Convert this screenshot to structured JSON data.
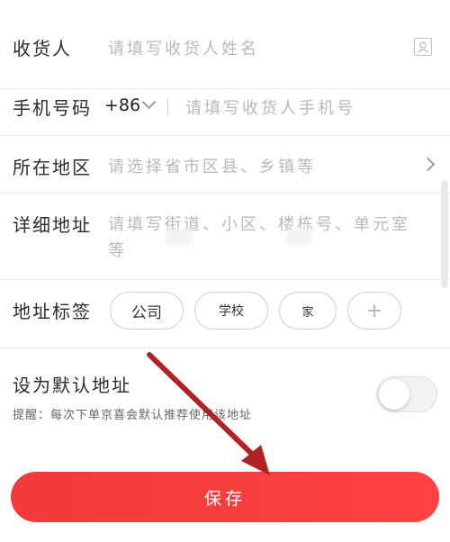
{
  "form": {
    "recipient": {
      "label": "收货人",
      "placeholder": "请填写收货人姓名"
    },
    "phone": {
      "label": "手机号码",
      "country_code": "+86",
      "placeholder": "请填写收货人手机号"
    },
    "region": {
      "label": "所在地区",
      "placeholder": "请选择省市区县、乡镇等"
    },
    "address": {
      "label": "详细地址",
      "placeholder_line1": "请填写街道、小区、楼栋号、单元室",
      "placeholder_line2": "等"
    },
    "tags": {
      "label": "地址标签",
      "items": [
        "公司",
        "学校",
        "家"
      ],
      "add": "+"
    },
    "default": {
      "label": "设为默认地址",
      "hint": "提醒：每次下单京喜会默认推荐使用该地址",
      "enabled": false
    }
  },
  "save_button": "保存",
  "icons": {
    "contacts": "contact-book-icon",
    "dropdown": "chevron-down-icon",
    "region_arrow": "chevron-right-icon"
  },
  "colors": {
    "accent": "#f33a3a",
    "placeholder": "#b9b9b9",
    "annotation_arrow": "#b22222"
  }
}
